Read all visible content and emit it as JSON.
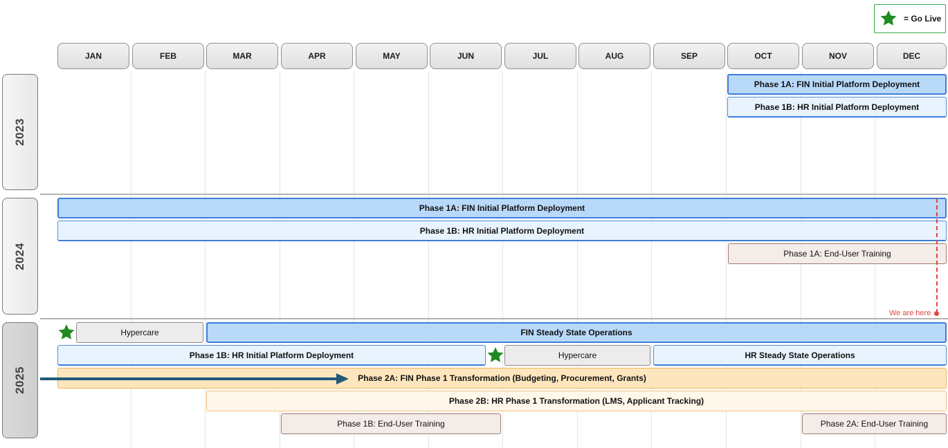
{
  "legend": {
    "label": "= Go Live",
    "star_icon": "star-icon",
    "color": "#1f8a1f"
  },
  "months": [
    "JAN",
    "FEB",
    "MAR",
    "APR",
    "MAY",
    "JUN",
    "JUL",
    "AUG",
    "SEP",
    "OCT",
    "NOV",
    "DEC"
  ],
  "years": {
    "y2023": "2023",
    "y2024": "2024",
    "y2025": "2025"
  },
  "row_2023": {
    "fin": "Phase 1A: FIN Initial Platform Deployment",
    "hr": "Phase 1B: HR Initial Platform Deployment"
  },
  "row_2024": {
    "fin": "Phase 1A: FIN Initial Platform Deployment",
    "hr": "Phase 1B: HR Initial Platform Deployment",
    "training": "Phase 1A: End-User Training",
    "we_are_here": "We are here"
  },
  "row_2025": {
    "hypercare_fin": "Hypercare",
    "fin_steady": "FIN Steady State Operations",
    "hr_initial": "Phase 1B: HR Initial Platform Deployment",
    "hypercare_hr": "Hypercare",
    "hr_steady": "HR Steady State Operations",
    "phase2a": "Phase 2A: FIN Phase 1 Transformation (Budgeting, Procurement, Grants)",
    "phase2b": "Phase 2B: HR Phase 1 Transformation (LMS, Applicant Tracking)",
    "training_1b": "Phase 1B: End-User Training",
    "training_2a": "Phase 2A: End-User Training"
  },
  "icons": {
    "go_live_star": "star-icon",
    "arrow": "arrow-right-icon"
  },
  "colors": {
    "blue": "#b9d9fa",
    "light_blue": "#e8f3fd",
    "training": "#f4ece8",
    "gray": "#ececec",
    "orange": "#fde6bd",
    "light_orange": "#fff7ea",
    "red_marker": "#e2463f",
    "arrow": "#1f5a7a",
    "green_star": "#1f8a1f"
  }
}
